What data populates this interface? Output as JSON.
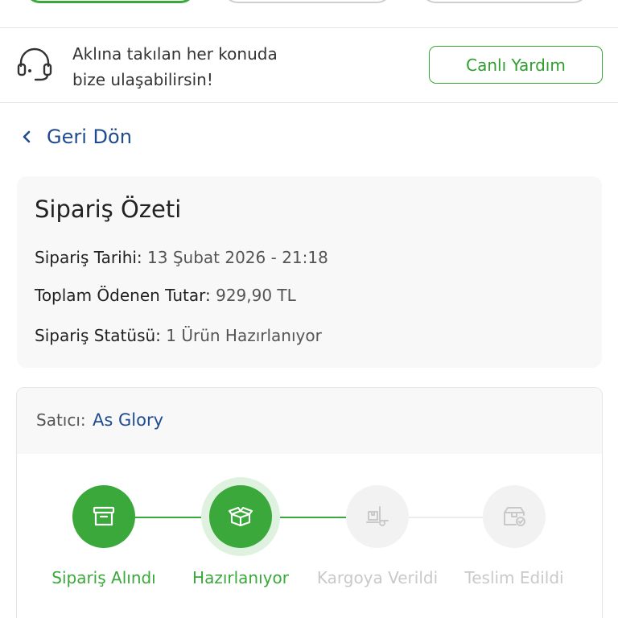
{
  "help": {
    "text_line1": "Aklına takılan her konuda",
    "text_line2": "bize ulaşabilirsin!",
    "button_label": "Canlı Yardım",
    "icon": "headset-icon"
  },
  "back": {
    "label": "Geri Dön",
    "icon": "chevron-left-icon"
  },
  "summary": {
    "title": "Sipariş Özeti",
    "date_label": "Sipariş Tarihi:",
    "date_value": "13 Şubat 2026 - 21:18",
    "total_label": "Toplam Ödenen Tutar:",
    "total_value": "929,90 TL",
    "status_label": "Sipariş Statüsü:",
    "status_value": "1 Ürün Hazırlanıyor"
  },
  "seller": {
    "label": "Satıcı:",
    "name": "As Glory"
  },
  "steps": [
    {
      "label": "Sipariş Alındı",
      "icon": "archive-box-icon",
      "state": "done"
    },
    {
      "label": "Hazırlanıyor",
      "icon": "open-box-icon",
      "state": "current"
    },
    {
      "label": "Kargoya Verildi",
      "icon": "hand-truck-icon",
      "state": "pending"
    },
    {
      "label": "Teslim Edildi",
      "icon": "delivered-box-icon",
      "state": "pending"
    }
  ],
  "colors": {
    "accent_green": "#3aa83a",
    "link_blue": "#1f4b8e",
    "inactive_gray": "#c9c9c9"
  }
}
